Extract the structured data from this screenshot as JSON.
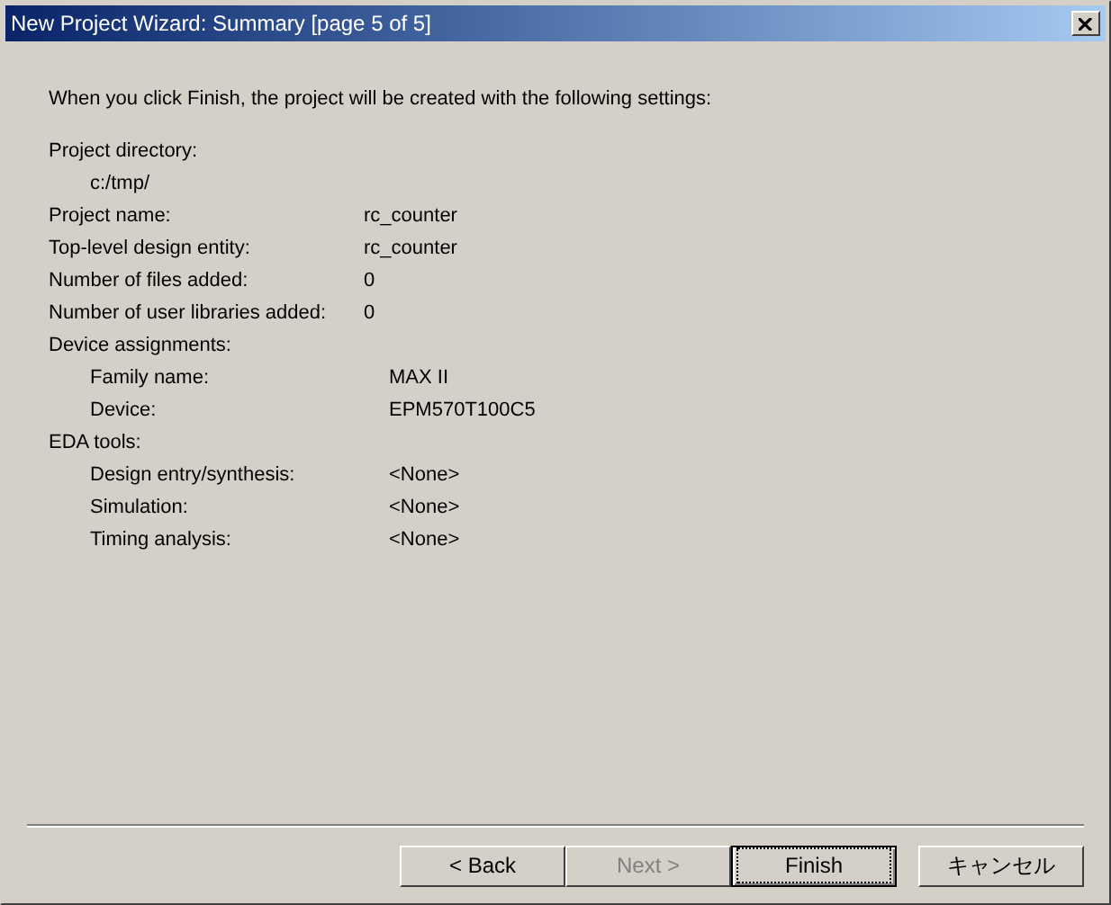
{
  "window": {
    "title": "New Project Wizard: Summary [page 5 of 5]"
  },
  "intro": "When you click Finish, the project will be created with the following settings:",
  "settings": [
    {
      "label": "Project directory:",
      "children": [
        {
          "label": "c:/tmp/"
        }
      ]
    },
    {
      "label": "Project name:",
      "value": "rc_counter"
    },
    {
      "label": "Top-level design entity:",
      "value": "rc_counter"
    },
    {
      "label": "Number of files added:",
      "value": "0"
    },
    {
      "label": "Number of user libraries added:",
      "value": "0"
    },
    {
      "label": "Device assignments:",
      "children": [
        {
          "label": "Family name:",
          "value": "MAX II"
        },
        {
          "label": "Device:",
          "value": "EPM570T100C5"
        }
      ]
    },
    {
      "label": "EDA tools:",
      "children": [
        {
          "label": "Design entry/synthesis:",
          "value": "<None>"
        },
        {
          "label": "Simulation:",
          "value": "<None>"
        },
        {
          "label": "Timing analysis:",
          "value": "<None>"
        }
      ]
    }
  ],
  "buttons": [
    {
      "label": "< Back",
      "disabled": false,
      "default": false
    },
    {
      "label": "Next >",
      "disabled": true,
      "default": false
    },
    {
      "label": "Finish",
      "disabled": false,
      "default": true
    },
    {
      "label": "キャンセル",
      "disabled": false,
      "default": false
    }
  ]
}
